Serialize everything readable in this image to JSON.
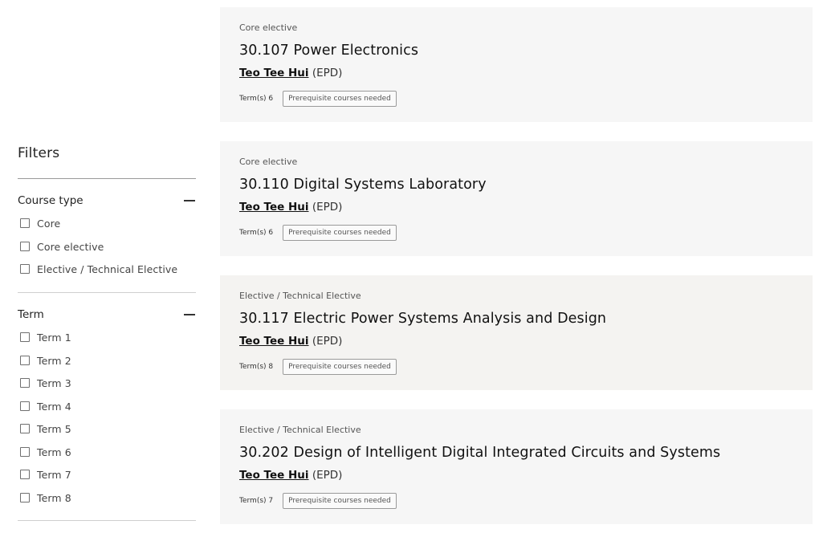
{
  "sidebar": {
    "title": "Filters",
    "groups": [
      {
        "title": "Course type",
        "options": [
          "Core",
          "Core elective",
          "Elective / Technical Elective"
        ]
      },
      {
        "title": "Term",
        "options": [
          "Term 1",
          "Term 2",
          "Term 3",
          "Term 4",
          "Term 5",
          "Term 6",
          "Term 7",
          "Term 8"
        ]
      }
    ]
  },
  "courses": [
    {
      "type": "Core elective",
      "title": "30.107 Power Electronics",
      "instructor": "Teo Tee Hui",
      "pillar": "(EPD)",
      "terms": "Term(s) 6",
      "prereq": "Prerequisite courses needed"
    },
    {
      "type": "Core elective",
      "title": "30.110 Digital Systems Laboratory",
      "instructor": "Teo Tee Hui",
      "pillar": "(EPD)",
      "terms": "Term(s) 6",
      "prereq": "Prerequisite courses needed"
    },
    {
      "type": "Elective / Technical Elective",
      "title": "30.117 Electric Power Systems Analysis and Design",
      "instructor": "Teo Tee Hui",
      "pillar": "(EPD)",
      "terms": "Term(s) 8",
      "prereq": "Prerequisite courses needed"
    },
    {
      "type": "Elective / Technical Elective",
      "title": "30.202 Design of Intelligent Digital Integrated Circuits and Systems",
      "instructor": "Teo Tee Hui",
      "pillar": "(EPD)",
      "terms": "Term(s) 7",
      "prereq": "Prerequisite courses needed"
    }
  ],
  "icons": {
    "collapse": "minus-icon",
    "checkbox": "checkbox-unchecked-icon"
  }
}
